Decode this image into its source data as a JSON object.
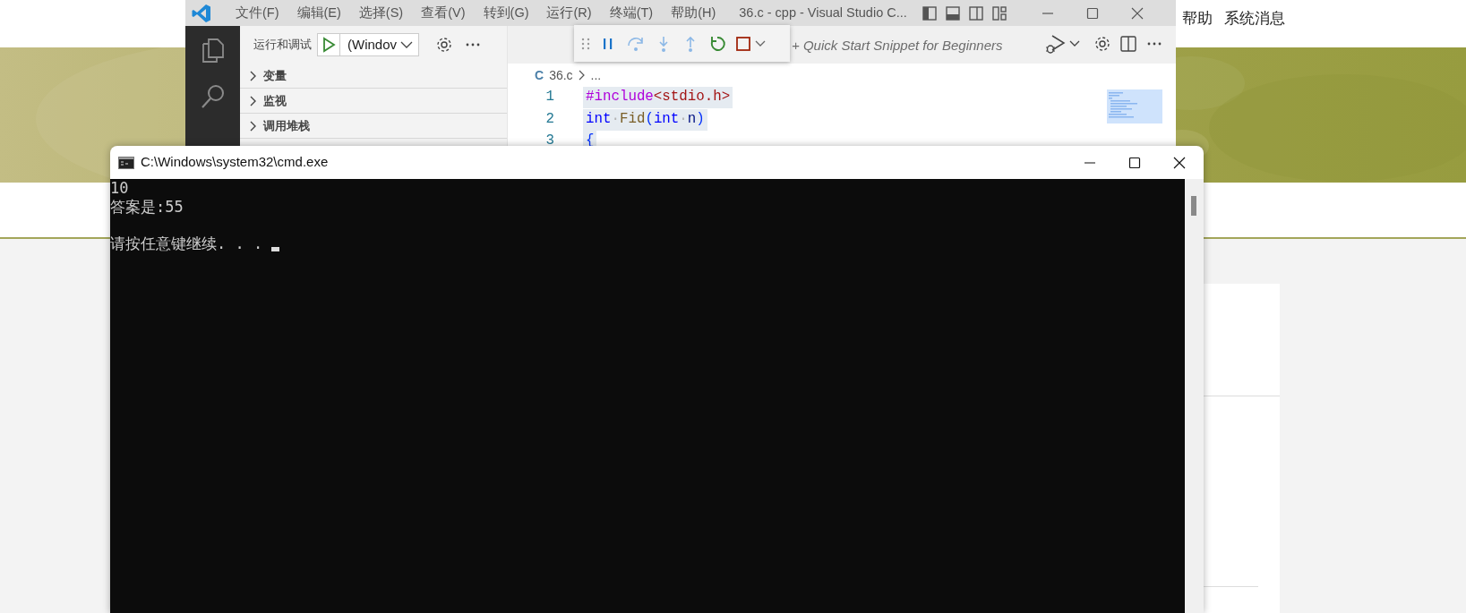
{
  "web_page": {
    "nav_links": [
      {
        "label": "帮助"
      },
      {
        "label": "系统消息"
      }
    ]
  },
  "vscode": {
    "menu": [
      {
        "label": "文件(F)"
      },
      {
        "label": "编辑(E)"
      },
      {
        "label": "选择(S)"
      },
      {
        "label": "查看(V)"
      },
      {
        "label": "转到(G)"
      },
      {
        "label": "运行(R)"
      },
      {
        "label": "终端(T)"
      },
      {
        "label": "帮助(H)"
      }
    ],
    "title": "36.c - cpp - Visual Studio C...",
    "run_debug": {
      "label": "运行和调试",
      "configuration": "(Windov"
    },
    "sections": [
      {
        "label": "变量",
        "expanded": false
      },
      {
        "label": "监视",
        "expanded": false
      },
      {
        "label": "调用堆栈",
        "expanded": false
      }
    ],
    "snippet_hint": "+ Quick Start Snippet for Beginners",
    "breadcrumb": {
      "language": "C",
      "file": "36.c",
      "more": "..."
    },
    "code_lines": [
      {
        "number": "1",
        "highlighted": true,
        "tokens": [
          {
            "text": "#include",
            "kind": "directive"
          },
          {
            "text": "<stdio.h>",
            "kind": "header"
          }
        ]
      },
      {
        "number": "2",
        "highlighted": true,
        "tokens": [
          {
            "text": "int",
            "kind": "keyword"
          },
          {
            "text": "·",
            "kind": "space"
          },
          {
            "text": "Fid",
            "kind": "function"
          },
          {
            "text": "(",
            "kind": "bracket"
          },
          {
            "text": "int",
            "kind": "keyword"
          },
          {
            "text": "·",
            "kind": "space"
          },
          {
            "text": "n",
            "kind": "param"
          },
          {
            "text": ")",
            "kind": "bracket"
          }
        ]
      },
      {
        "number": "3",
        "highlighted": true,
        "tokens": [
          {
            "text": "{",
            "kind": "bracket"
          }
        ]
      }
    ]
  },
  "cmd": {
    "title": "C:\\Windows\\system32\\cmd.exe",
    "output": [
      {
        "text": "10"
      },
      {
        "text": "答案是:55"
      }
    ],
    "prompt": "请按任意键继续. . . "
  }
}
